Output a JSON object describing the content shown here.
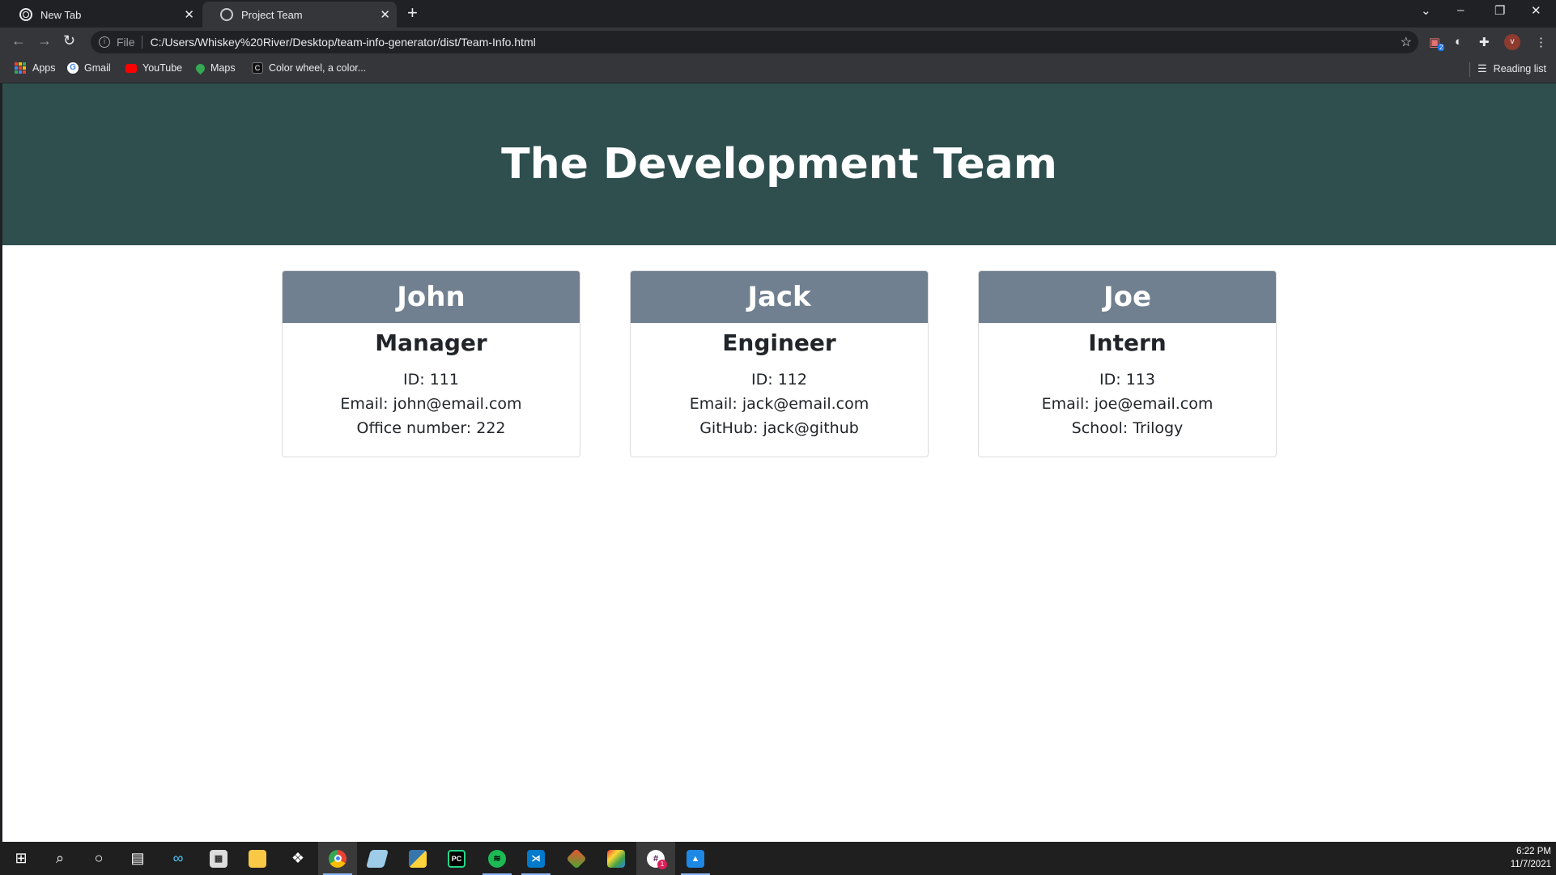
{
  "browser": {
    "tabs": [
      {
        "title": "New Tab",
        "active": false
      },
      {
        "title": "Project Team",
        "active": true
      }
    ],
    "address": {
      "scheme": "File",
      "url": "C:/Users/Whiskey%20River/Desktop/team-info-generator/dist/Team-Info.html"
    },
    "profile_initial": "v",
    "bookmarks": [
      {
        "label": "Apps",
        "icon": "apps-grid-icon"
      },
      {
        "label": "Gmail",
        "icon": "google-icon"
      },
      {
        "label": "YouTube",
        "icon": "youtube-icon"
      },
      {
        "label": "Maps",
        "icon": "maps-pin-icon"
      },
      {
        "label": "Color wheel, a color...",
        "icon": "color-wheel-icon"
      }
    ],
    "reading_list": "Reading list"
  },
  "page": {
    "title": "The Development Team",
    "colors": {
      "header_bg": "#2f4f4f",
      "card_header_bg": "#708090"
    },
    "team": [
      {
        "name": "John",
        "role": "Manager",
        "id": "ID: 111",
        "email": "Email: john@email.com",
        "extra": "Office number: 222"
      },
      {
        "name": "Jack",
        "role": "Engineer",
        "id": "ID: 112",
        "email": "Email: jack@email.com",
        "extra": "GitHub: jack@github"
      },
      {
        "name": "Joe",
        "role": "Intern",
        "id": "ID: 113",
        "email": "Email: joe@email.com",
        "extra": "School: Trilogy"
      }
    ]
  },
  "taskbar": {
    "time": "6:22 PM",
    "date": "11/7/2021",
    "slack_badge": "1",
    "ext_badge": "2"
  }
}
